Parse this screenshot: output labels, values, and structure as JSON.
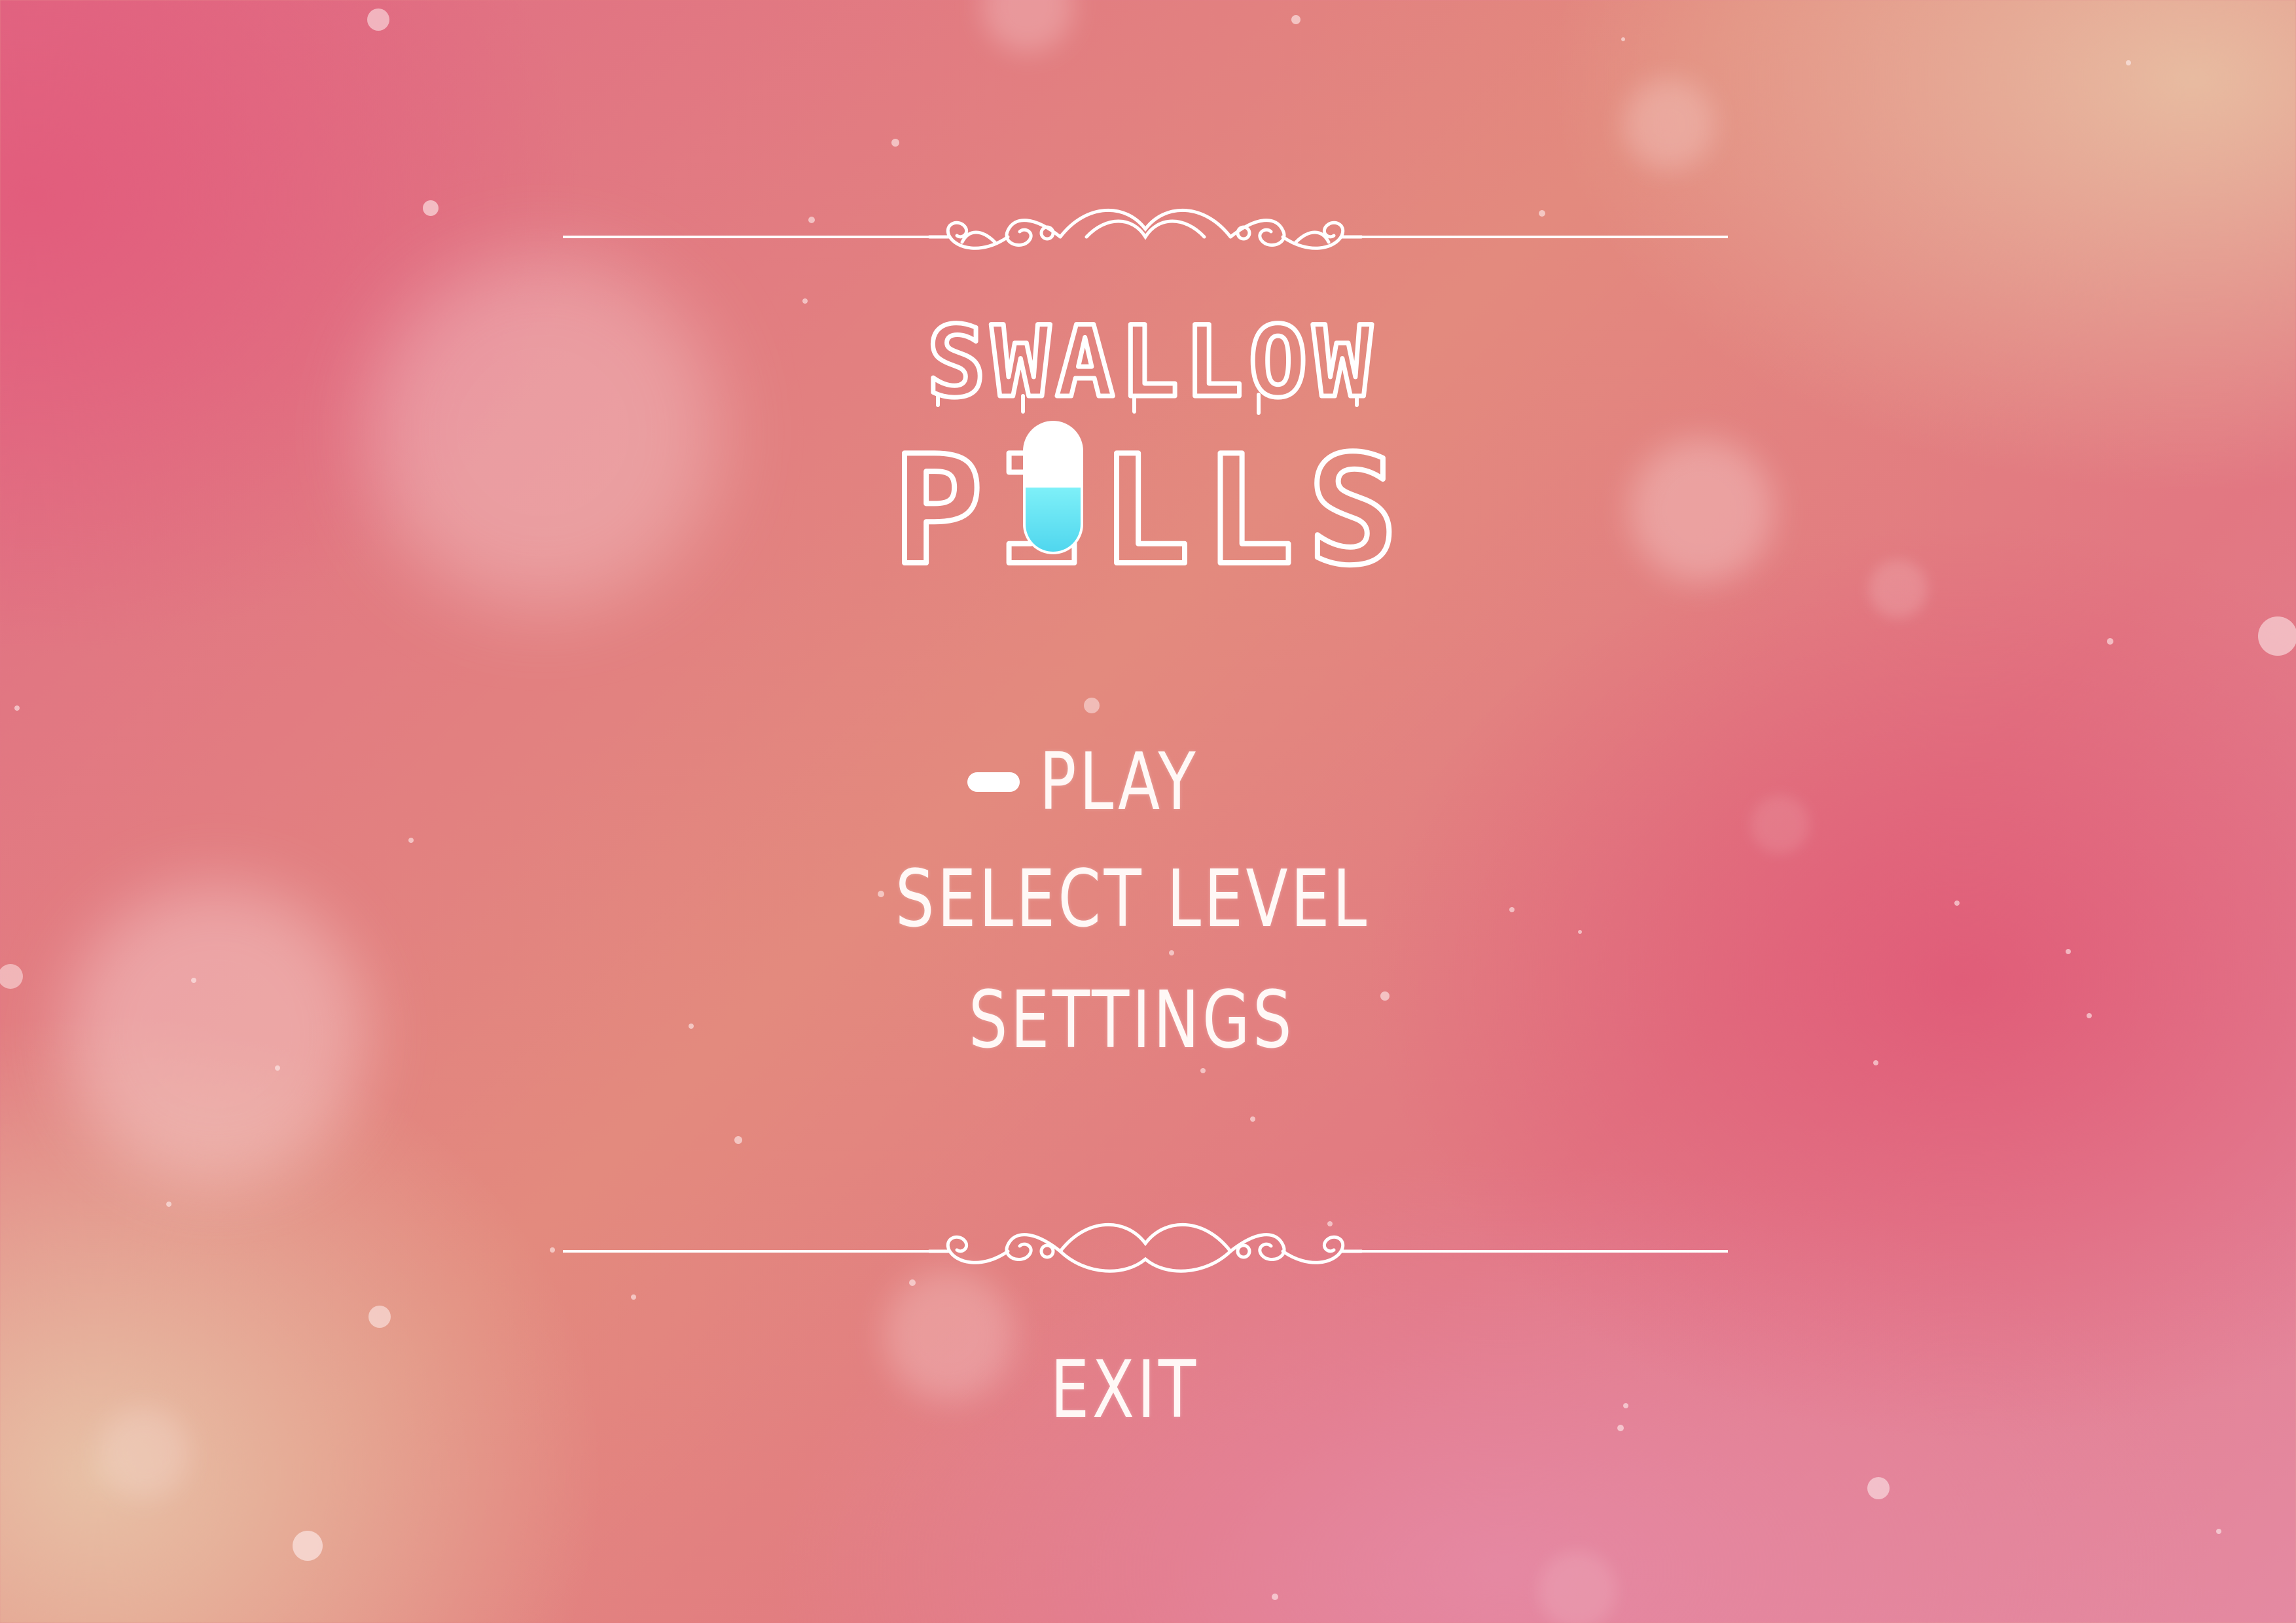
{
  "game": {
    "title_line1": "SWALLOW",
    "title_line2": "PILLS"
  },
  "menu": {
    "items": [
      {
        "label": "PLAY",
        "selected": true
      },
      {
        "label": "SELECT LEVEL",
        "selected": false
      },
      {
        "label": "SETTINGS",
        "selected": false
      }
    ],
    "exit_label": "EXIT"
  },
  "colors": {
    "text": "#ffffff",
    "pill_top": "#ffffff",
    "pill_bottom": "#5fe3f2",
    "background_pink": "#e06a85",
    "background_peach": "#e8c4a8"
  },
  "icons": {
    "selector": "pill-selector-icon",
    "ornament": "scroll-ornament-icon"
  }
}
